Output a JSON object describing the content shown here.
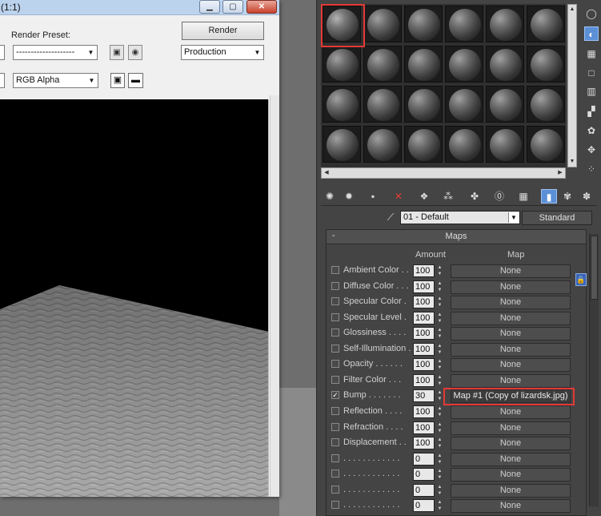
{
  "render_frame": {
    "title": "(1:1)",
    "window_buttons": {
      "minimize": "▁",
      "maximize": "▢",
      "close": "✕"
    },
    "render_preset_label": "Render Preset:",
    "render_preset_value": "--------------------",
    "render_button": "Render",
    "production_value": "Production",
    "channel_value": "RGB Alpha"
  },
  "material_editor": {
    "slot_rows": 4,
    "slot_cols": 6,
    "active_slot": 0,
    "material_name": "01 - Default",
    "material_type": "Standard",
    "maps_rollout": {
      "collapse": "-",
      "title": "Maps",
      "col_amount": "Amount",
      "col_map": "Map",
      "rows": [
        {
          "label": "Ambient Color . .",
          "checked": false,
          "amount": "100",
          "map": "None"
        },
        {
          "label": "Diffuse Color . . .",
          "checked": false,
          "amount": "100",
          "map": "None"
        },
        {
          "label": "Specular Color  .",
          "checked": false,
          "amount": "100",
          "map": "None"
        },
        {
          "label": "Specular Level  .",
          "checked": false,
          "amount": "100",
          "map": "None"
        },
        {
          "label": "Glossiness  . . . .",
          "checked": false,
          "amount": "100",
          "map": "None"
        },
        {
          "label": "Self-Illumination .",
          "checked": false,
          "amount": "100",
          "map": "None"
        },
        {
          "label": "Opacity . . . . . .",
          "checked": false,
          "amount": "100",
          "map": "None"
        },
        {
          "label": "Filter Color  . . .",
          "checked": false,
          "amount": "100",
          "map": "None"
        },
        {
          "label": "Bump  . . . . . . .",
          "checked": true,
          "amount": "30",
          "map": "Map #1 (Copy of lizardsk.jpg)"
        },
        {
          "label": "Reflection  . . . .",
          "checked": false,
          "amount": "100",
          "map": "None"
        },
        {
          "label": "Refraction  . . . .",
          "checked": false,
          "amount": "100",
          "map": "None"
        },
        {
          "label": "Displacement  . .",
          "checked": false,
          "amount": "100",
          "map": "None"
        },
        {
          "label": ". . . . . . . . . . . .",
          "checked": false,
          "amount": "0",
          "map": "None"
        },
        {
          "label": ". . . . . . . . . . . .",
          "checked": false,
          "amount": "0",
          "map": "None"
        },
        {
          "label": ". . . . . . . . . . . .",
          "checked": false,
          "amount": "0",
          "map": "None"
        },
        {
          "label": ". . . . . . . . . . . .",
          "checked": false,
          "amount": "0",
          "map": "None"
        }
      ]
    },
    "side_tools": [
      "sample-sphere-icon",
      "backlight-icon",
      "checker-background-icon",
      "sample-uv-icon",
      "video-color-check-icon",
      "make-preview-icon",
      "options-icon",
      "select-by-material-icon",
      "material-navigator-icon"
    ],
    "bottom_tools": [
      "get-material-icon",
      "put-to-scene-icon",
      "assign-to-selection-icon",
      "reset-map-icon",
      "make-copy-icon",
      "make-unique-icon",
      "put-to-library-icon",
      "material-id-channel-icon",
      "show-map-icon",
      "show-end-result-icon",
      "go-to-parent-icon",
      "go-forward-sibling-icon"
    ]
  }
}
